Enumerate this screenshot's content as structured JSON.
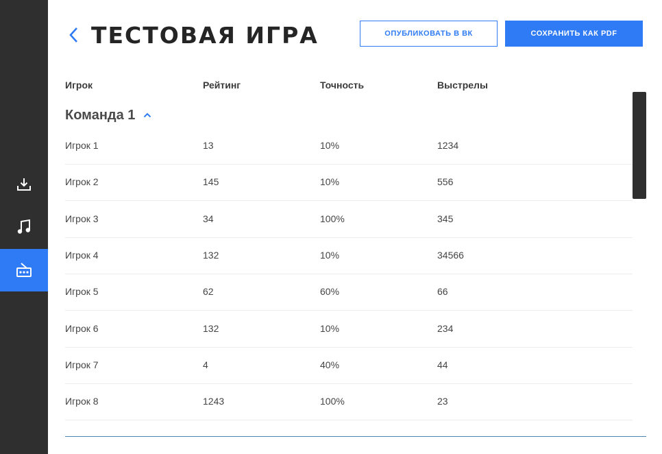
{
  "header": {
    "title": "ТЕСТОВАЯ ИГРА",
    "publish_label": "ОПУБЛИКОВАТЬ В ВК",
    "save_pdf_label": "СОХРАНИТЬ КАК PDF"
  },
  "sidebar": {
    "items": [
      {
        "icon": "download-icon",
        "active": false
      },
      {
        "icon": "music-icon",
        "active": false
      },
      {
        "icon": "radio-icon",
        "active": true
      }
    ]
  },
  "table": {
    "columns": [
      "Игрок",
      "Рейтинг",
      "Точность",
      "Выстрелы"
    ],
    "team": {
      "label": "Команда 1",
      "expanded": true,
      "rows": [
        [
          "Игрок 1",
          "13",
          "10%",
          "1234"
        ],
        [
          "Игрок 2",
          "145",
          "10%",
          "556"
        ],
        [
          "Игрок 3",
          "34",
          "100%",
          "345"
        ],
        [
          "Игрок 4",
          "132",
          "10%",
          "34566"
        ],
        [
          "Игрок 5",
          "62",
          "60%",
          "66"
        ],
        [
          "Игрок 6",
          "132",
          "10%",
          "234"
        ],
        [
          "Игрок 7",
          "4",
          "40%",
          "44"
        ],
        [
          "Игрок 8",
          "1243",
          "100%",
          "23"
        ]
      ]
    }
  },
  "colors": {
    "accent": "#2f7bf5",
    "sidebar": "#2f2f2f"
  }
}
